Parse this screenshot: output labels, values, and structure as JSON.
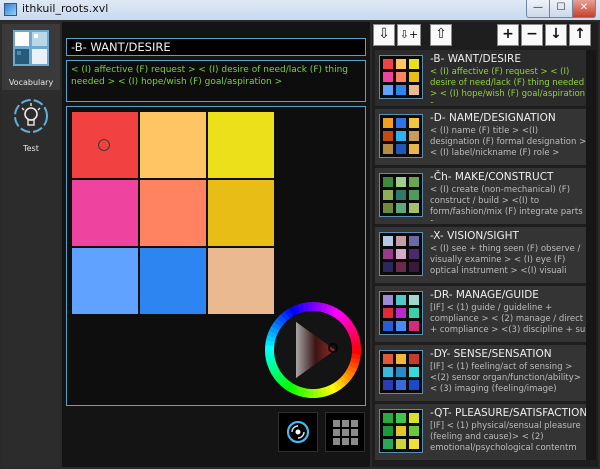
{
  "window": {
    "title": "ithkuil_roots.xvl",
    "minimize": "—",
    "maximize": "☐",
    "close": "✕"
  },
  "nav": {
    "vocabulary": "Vocabulary",
    "test": "Test"
  },
  "selected": {
    "header": "-B-  WANT/DESIRE",
    "description": "< (I) affective (F) request > < (I) desire of need/lack (F) thing needed > < (I) hope/wish (F) goal/aspiration >",
    "swatches": [
      "#f24141",
      "#ffc463",
      "#ebe01a",
      "#ef43a0",
      "#ff8361",
      "#e8bd16",
      "#5fa2ff",
      "#2c85f1",
      "#ebb98f"
    ]
  },
  "toolbar": {
    "prev": "⇩",
    "add": "⇩+",
    "top": "⇧",
    "plus": "+",
    "minus": "−",
    "down": "↓",
    "up": "↑"
  },
  "cards": [
    {
      "title": "-B-  WANT/DESIRE",
      "desc": "< (I) affective (F) request > < (I) desire of need/lack (F) thing needed > < (I) hope/wish (F) goal/aspiration >",
      "colors": [
        "#f24141",
        "#ffc463",
        "#ebe01a",
        "#ef43a0",
        "#ff8361",
        "#e8bd16",
        "#5fa2ff",
        "#2c85f1",
        "#ebb98f"
      ]
    },
    {
      "title": "-D-  NAME/DESIGNATION",
      "desc": "< (I) name (F) title > <(I) designation (F) formal designation > < (I) label/nickname (F) role >",
      "colors": [
        "#f2a01e",
        "#2f74e0",
        "#f2c63a",
        "#c24a17",
        "#2fb0f0",
        "#c79b5a",
        "#b58a43",
        "#1f58b8",
        "#e8b44c"
      ]
    },
    {
      "title": "-Čh-  MAKE/CONSTRUCT",
      "desc": "< (I) create (non-mechanical) (F) construct / build > <(I) to form/fashion/mix (F) integrate parts >",
      "colors": [
        "#3f8a3f",
        "#9fcf8f",
        "#6aa64f",
        "#8fae5a",
        "#2f7a6a",
        "#4f9a5f",
        "#6f8a3a",
        "#5fa87a",
        "#a5c06a"
      ]
    },
    {
      "title": "-X-  VISION/SIGHT",
      "desc": "< (I) see + thing seen (F) observe / visually examine > < (I) eye (F) optical instrument > <(I) visuali",
      "colors": [
        "#b7c7e8",
        "#c79ba8",
        "#6a6aa8",
        "#9a3a8a",
        "#d8a8c8",
        "#4a2a6a",
        "#2a2a5a",
        "#6a2a4a",
        "#3a1a3a"
      ]
    },
    {
      "title": "-DR-  MANAGE/GUIDE",
      "desc": "[IF] < (1) guide / guideline + compliance > < (2)  manage / direct + compliance > <(3) discipline + su",
      "colors": [
        "#9f8ad8",
        "#4fc8c8",
        "#a0d8d0",
        "#e02a3a",
        "#b82ad0",
        "#3ad0a8",
        "#2a5ad8",
        "#4a8af8",
        "#d82a7a"
      ]
    },
    {
      "title": "-DY-  SENSE/SENSATION",
      "desc": "[IF] < (1)  feeling/act of sensing > <(2) sensor organ/function/ability> < (3) imaging (feeling/image)",
      "colors": [
        "#e05a3a",
        "#f2b83a",
        "#c83a2a",
        "#3ab8e0",
        "#2a8ac8",
        "#3ad8d8",
        "#2a3ab8",
        "#3a6ad8",
        "#1a4ac8"
      ]
    },
    {
      "title": "-QT-  PLEASURE/SATISFACTION",
      "desc": "[IF] < (1)  physical/sensual pleasure (feeling and cause)> < (2) emotional/psychological contentm",
      "colors": [
        "#2aa83a",
        "#3ac84a",
        "#d8e02a",
        "#1a9a3a",
        "#e0c82a",
        "#6ac83a",
        "#2aa85a",
        "#c8d83a",
        "#f2e03a"
      ]
    }
  ]
}
